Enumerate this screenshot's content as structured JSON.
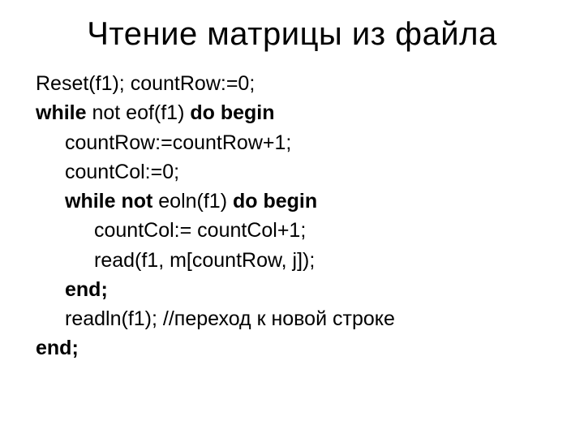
{
  "title": "Чтение матрицы из файла",
  "code": {
    "l1a": "Reset(f1); countRow:=0;",
    "l2a": "while",
    "l2b": " not eof(f1) ",
    "l2c": "do begin",
    "l3a": "countRow:=countRow+1;",
    "l4a": "countCol:=0;",
    "l5a": "while not",
    "l5b": " eoln(f1) ",
    "l5c": "do begin",
    "l6a": "countCol:= countCol+1;",
    "l7a": "read(f1, m[countRow, j]);",
    "l8a": "end;",
    "l9a": "readln(f1); //переход к новой строке",
    "l10a": "end;"
  }
}
